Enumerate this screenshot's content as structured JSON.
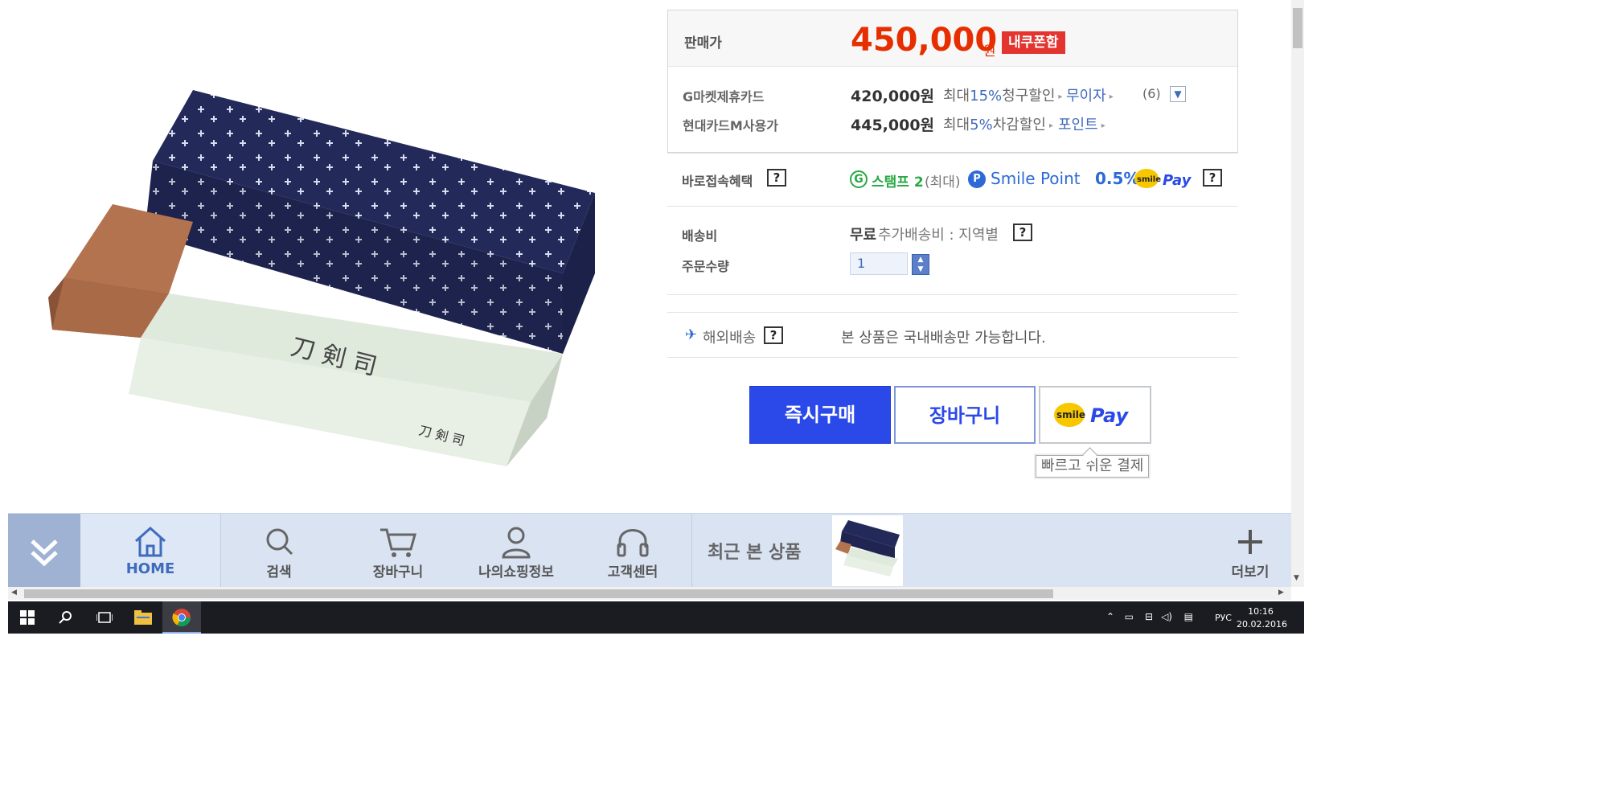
{
  "price": {
    "label": "판매가",
    "value": "450,000",
    "unit": "원",
    "coupon_badge": "내쿠폰함"
  },
  "cards": [
    {
      "label": "G마켓제휴카드",
      "amount": "420,000원",
      "discount_prefix": "최대",
      "discount_pct": "15%",
      "discount_suffix": "청구할인",
      "link": "무이자",
      "count": "(6)"
    },
    {
      "label": "현대카드M사용가",
      "amount": "445,000원",
      "discount_prefix": "최대",
      "discount_pct": "5%",
      "discount_suffix": "차감할인",
      "link": "포인트"
    }
  ],
  "benefit": {
    "label": "바로접속혜택",
    "stamp_icon": "G",
    "stamp_text": "스탬프 2",
    "stamp_max": "(최대)",
    "smile_point_icon": "P",
    "smile_point_text": "Smile Point",
    "smile_point_pct": "0.5%"
  },
  "shipping": {
    "label": "배송비",
    "free": "무료",
    "extra": "추가배송비 : 지역별"
  },
  "quantity": {
    "label": "주문수량",
    "value": "1"
  },
  "overseas": {
    "label": "해외배송",
    "text": "본 상품은 국내배송만 가능합니다."
  },
  "help_label": "?",
  "buttons": {
    "buy_now": "즉시구매",
    "cart": "장바구니",
    "smilepay_tooltip": "빠르고 쉬운 결제"
  },
  "smilepay_logo": {
    "smile": "smile",
    "pay": "Pay"
  },
  "bottom_nav": {
    "items": [
      {
        "label": "HOME",
        "icon": "home-icon"
      },
      {
        "label": "검색",
        "icon": "search-icon"
      },
      {
        "label": "장바구니",
        "icon": "cart-icon"
      },
      {
        "label": "나의쇼핑정보",
        "icon": "user-icon"
      },
      {
        "label": "고객센터",
        "icon": "headset-icon"
      }
    ],
    "recent_label": "최근 본 상품",
    "more_label": "더보기"
  },
  "taskbar": {
    "lang": "РУС",
    "time": "10:16",
    "date": "20.02.2016"
  },
  "colors": {
    "price_red": "#e62e00",
    "buy_blue": "#2a49e8",
    "link_blue": "#3f6bbd",
    "stamp_green": "#27a843",
    "nav_bg": "#d9e3f2"
  }
}
